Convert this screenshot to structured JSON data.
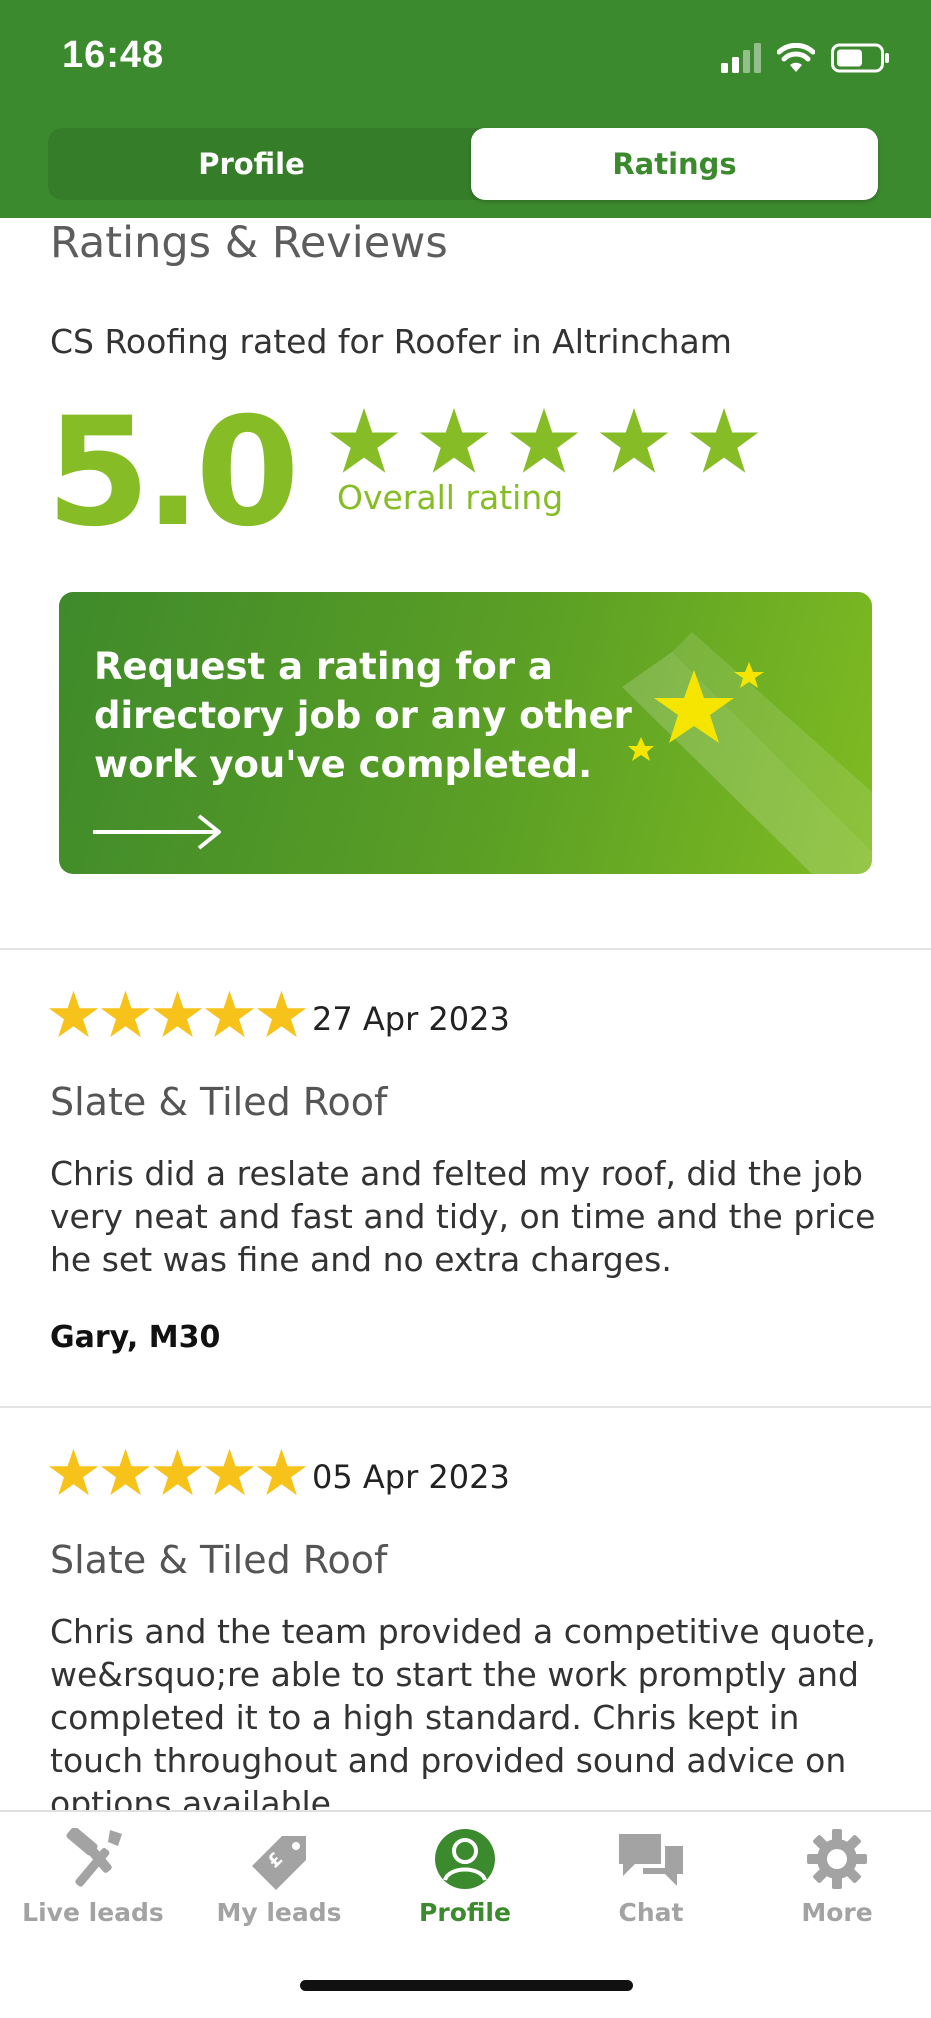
{
  "status_bar": {
    "time": "16:48"
  },
  "tabs": {
    "profile": "Profile",
    "ratings": "Ratings"
  },
  "header": {
    "title": "Ratings & Reviews",
    "subtitle": "CS Roofing rated for Roofer in Altrincham",
    "score": "5.0",
    "overall_label": "Overall rating",
    "stars": 5
  },
  "banner": {
    "text": "Request a rating for a directory job or any other work you've completed."
  },
  "reviews": [
    {
      "date": "27 Apr 2023",
      "title": "Slate & Tiled Roof",
      "body": "Chris did a reslate and felted my roof, did the job very neat and fast and tidy, on time and the price he set was fine and no extra charges.",
      "author": "Gary, M30",
      "stars": 5
    },
    {
      "date": "05 Apr 2023",
      "title": "Slate & Tiled Roof",
      "body": "Chris and the team provided a competitive quote, we&rsquo;re able to start the work promptly and completed it to a high standard. Chris kept in touch throughout and provided sound advice on options available.",
      "stars": 5
    }
  ],
  "bottom_nav": [
    {
      "label": "Live leads",
      "icon": "hammer-icon"
    },
    {
      "label": "My leads",
      "icon": "price-tag-icon"
    },
    {
      "label": "Profile",
      "icon": "profile-icon",
      "active": true
    },
    {
      "label": "Chat",
      "icon": "chat-icon"
    },
    {
      "label": "More",
      "icon": "gear-icon"
    }
  ],
  "colors": {
    "brand_green": "#3c8a2e",
    "rating_green": "#86bc25",
    "star_gold": "#f7c21a"
  }
}
